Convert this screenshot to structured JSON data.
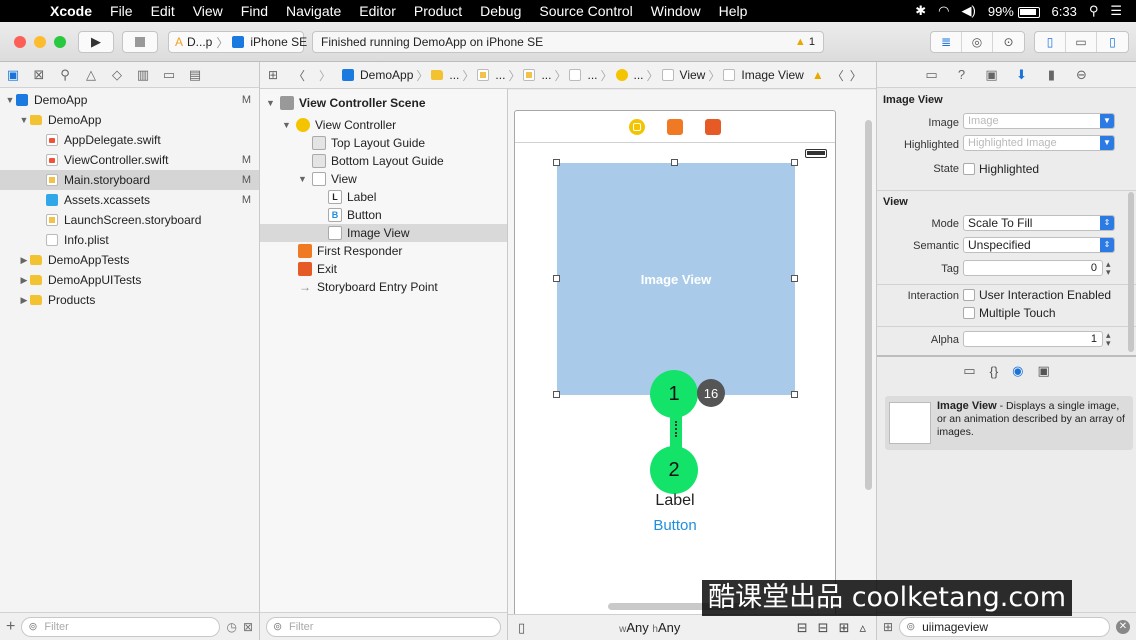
{
  "menubar": {
    "app": "Xcode",
    "items": [
      "File",
      "Edit",
      "View",
      "Find",
      "Navigate",
      "Editor",
      "Product",
      "Debug",
      "Source Control",
      "Window",
      "Help"
    ],
    "battery": "99%",
    "time": "6:33"
  },
  "toolbar": {
    "scheme": "D...p",
    "device": "iPhone SE",
    "status": "Finished running DemoApp on iPhone SE",
    "warning_count": "1"
  },
  "navigator": {
    "items": [
      {
        "label": "DemoApp",
        "badge": "M"
      },
      {
        "label": "DemoApp",
        "badge": ""
      },
      {
        "label": "AppDelegate.swift",
        "badge": ""
      },
      {
        "label": "ViewController.swift",
        "badge": "M"
      },
      {
        "label": "Main.storyboard",
        "badge": "M"
      },
      {
        "label": "Assets.xcassets",
        "badge": "M"
      },
      {
        "label": "LaunchScreen.storyboard",
        "badge": ""
      },
      {
        "label": "Info.plist",
        "badge": ""
      },
      {
        "label": "DemoAppTests",
        "badge": ""
      },
      {
        "label": "DemoAppUITests",
        "badge": ""
      },
      {
        "label": "Products",
        "badge": ""
      }
    ],
    "filter_placeholder": "Filter"
  },
  "jumpbar": {
    "project": "DemoApp",
    "ellipsis": "...",
    "view": "View",
    "imageview": "Image View"
  },
  "outline": {
    "items": [
      {
        "label": "View Controller Scene"
      },
      {
        "label": "View Controller"
      },
      {
        "label": "Top Layout Guide"
      },
      {
        "label": "Bottom Layout Guide"
      },
      {
        "label": "View"
      },
      {
        "label": "Label",
        "icon": "L"
      },
      {
        "label": "Button",
        "icon": "B"
      },
      {
        "label": "Image View"
      },
      {
        "label": "First Responder"
      },
      {
        "label": "Exit"
      },
      {
        "label": "Storyboard Entry Point"
      }
    ],
    "filter_placeholder": "Filter"
  },
  "canvas": {
    "image_view_label": "Image View",
    "label_text": "Label",
    "button_text": "Button",
    "step1": "1",
    "step2": "2",
    "count_badge": "16",
    "size_w_prefix": "w",
    "size_w": "Any",
    "size_h_prefix": "h",
    "size_h": "Any"
  },
  "inspector": {
    "image_view_section": "Image View",
    "image_label": "Image",
    "image_placeholder": "Image",
    "highlighted_label": "Highlighted",
    "highlighted_placeholder": "Highlighted Image",
    "state_label": "State",
    "state_checkbox": "Highlighted",
    "view_section": "View",
    "mode_label": "Mode",
    "mode_value": "Scale To Fill",
    "semantic_label": "Semantic",
    "semantic_value": "Unspecified",
    "tag_label": "Tag",
    "tag_value": "0",
    "interaction_label": "Interaction",
    "interaction_check1": "User Interaction Enabled",
    "interaction_check2": "Multiple Touch",
    "alpha_label": "Alpha",
    "alpha_value": "1",
    "library_title": "Image View",
    "library_desc": " - Displays a single image, or an animation described by an array of images.",
    "library_search": "uiimageview"
  },
  "watermark": "酷课堂出品 coolketang.com",
  "colors": {
    "accent": "#1a73d9",
    "connection_green": "#14e36a",
    "image_view_fill": "#a9cbe9",
    "button_blue": "#1e8ee0"
  }
}
